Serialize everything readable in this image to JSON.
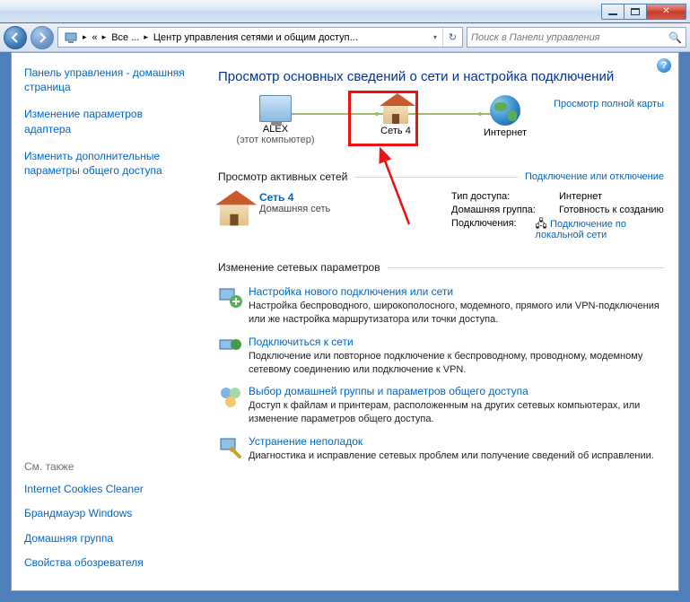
{
  "address": {
    "root_sep": "«",
    "crumb1": "Все ...",
    "crumb2": "Центр управления сетями и общим доступ..."
  },
  "search": {
    "placeholder": "Поиск в Панели управления"
  },
  "sidebar": {
    "home": "Панель управления - домашняя страница",
    "adapter": "Изменение параметров адаптера",
    "sharing": "Изменить дополнительные параметры общего доступа",
    "see_also_hdr": "См. также",
    "icc": "Internet Cookies Cleaner",
    "firewall": "Брандмауэр Windows",
    "homegroup": "Домашняя группа",
    "browser": "Свойства обозревателя"
  },
  "content": {
    "title": "Просмотр основных сведений о сети и настройка подключений",
    "full_map": "Просмотр полной карты",
    "node1": {
      "name": "ALEX",
      "sub": "(этот компьютер)"
    },
    "node2": {
      "name": "Сеть  4"
    },
    "node3": {
      "name": "Интернет"
    },
    "active_hdr": "Просмотр активных сетей",
    "connect_link": "Подключение или отключение",
    "net_name": "Сеть  4",
    "net_type": "Домашняя сеть",
    "props": {
      "k1": "Тип доступа:",
      "v1": "Интернет",
      "k2": "Домашняя группа:",
      "v2": "Готовность к созданию",
      "k3": "Подключения:",
      "v3": "Подключение по локальной сети"
    },
    "change_hdr": "Изменение сетевых параметров",
    "tasks": [
      {
        "title": "Настройка нового подключения или сети",
        "desc": "Настройка беспроводного, широкополосного, модемного, прямого или VPN-подключения или же настройка маршрутизатора или точки доступа."
      },
      {
        "title": "Подключиться к сети",
        "desc": "Подключение или повторное подключение к беспроводному, проводному, модемному сетевому соединению или подключение к VPN."
      },
      {
        "title": "Выбор домашней группы и параметров общего доступа",
        "desc": "Доступ к файлам и принтерам, расположенным на других сетевых компьютерах, или изменение параметров общего доступа."
      },
      {
        "title": "Устранение неполадок",
        "desc": "Диагностика и исправление сетевых проблем или получение сведений об исправлении."
      }
    ]
  }
}
